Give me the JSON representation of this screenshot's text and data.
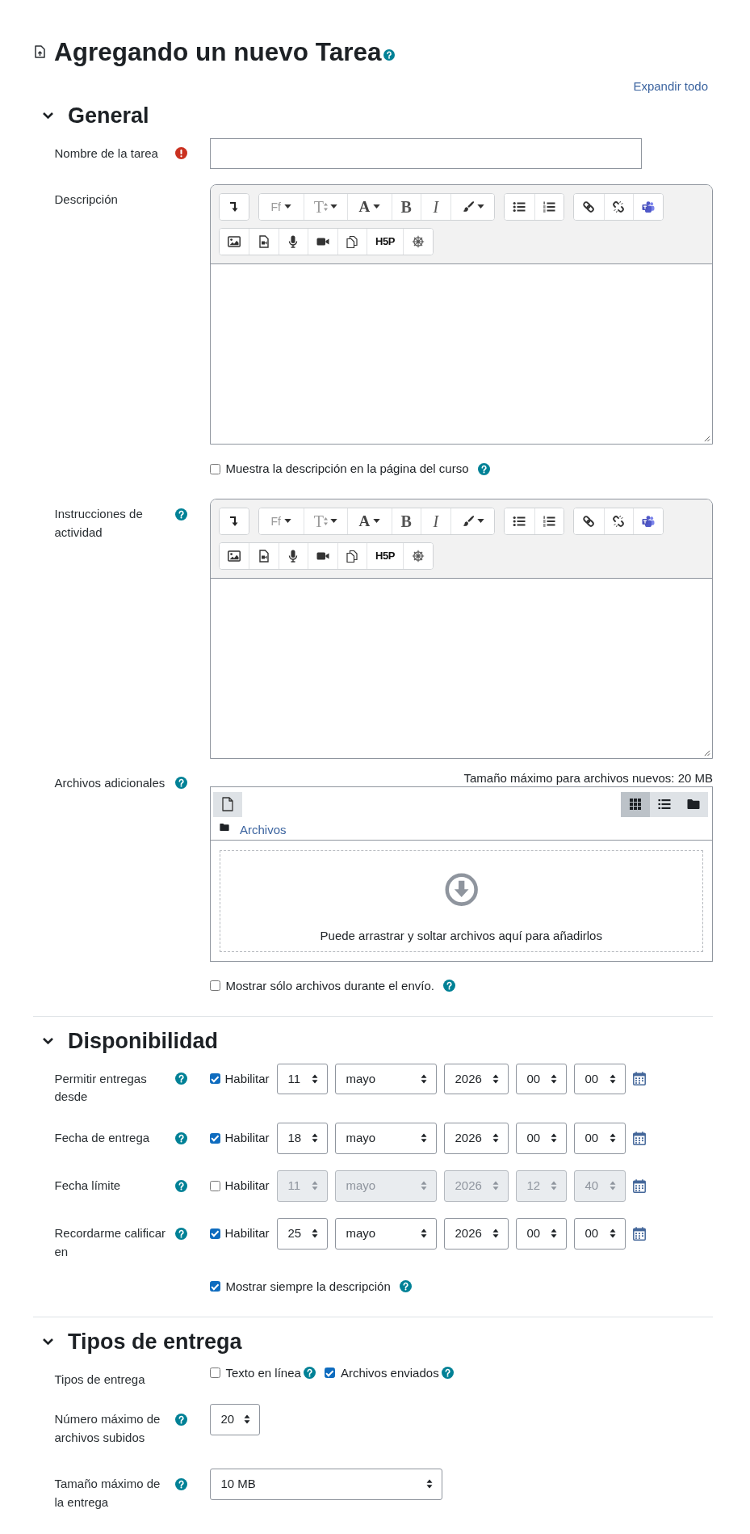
{
  "header": {
    "title": "Agregando un nuevo Tarea",
    "help": true,
    "expand_all": "Expandir todo"
  },
  "sections": [
    {
      "title": "General",
      "expanded": true,
      "fields": [
        {
          "kind": "text",
          "label": "Nombre de la tarea",
          "required": true,
          "help": false
        },
        {
          "kind": "editor",
          "label": "Descripción",
          "required": false,
          "help": false,
          "toolbar": [
            [
              [
                {
                  "kind": "expand"
                }
              ],
              [
                {
                  "kind": "font-family",
                  "glyph": "Ff"
                },
                {
                  "kind": "font-size",
                  "glyph": "T"
                },
                {
                  "kind": "font-color",
                  "glyph": "A"
                },
                {
                  "kind": "bold",
                  "glyph": "B"
                },
                {
                  "kind": "italic",
                  "glyph": "I"
                },
                {
                  "kind": "highlight"
                }
              ],
              [
                {
                  "kind": "bullets"
                },
                {
                  "kind": "numbers"
                }
              ],
              [
                {
                  "kind": "link"
                },
                {
                  "kind": "unlink"
                },
                {
                  "kind": "meeting"
                }
              ]
            ],
            [
              [
                {
                  "kind": "image"
                },
                {
                  "kind": "media"
                },
                {
                  "kind": "record-audio"
                },
                {
                  "kind": "record-video"
                },
                {
                  "kind": "manage-files"
                },
                {
                  "kind": "h5p",
                  "glyph": "H5P"
                },
                {
                  "kind": "wheel"
                }
              ]
            ]
          ]
        },
        {
          "kind": "checkbox",
          "label": "Muestra la descripción en la página del curso",
          "checked": false,
          "help": true
        },
        {
          "kind": "editor",
          "label": "Instrucciones de actividad",
          "required": false,
          "help": true,
          "toolbar": [
            [
              [
                {
                  "kind": "expand"
                }
              ],
              [
                {
                  "kind": "font-family",
                  "glyph": "Ff"
                },
                {
                  "kind": "font-size",
                  "glyph": "T"
                },
                {
                  "kind": "font-color",
                  "glyph": "A"
                },
                {
                  "kind": "bold",
                  "glyph": "B"
                },
                {
                  "kind": "italic",
                  "glyph": "I"
                },
                {
                  "kind": "highlight"
                }
              ],
              [
                {
                  "kind": "bullets"
                },
                {
                  "kind": "numbers"
                }
              ],
              [
                {
                  "kind": "link"
                },
                {
                  "kind": "unlink"
                },
                {
                  "kind": "meeting"
                }
              ]
            ],
            [
              [
                {
                  "kind": "image"
                },
                {
                  "kind": "media"
                },
                {
                  "kind": "record-audio"
                },
                {
                  "kind": "record-video"
                },
                {
                  "kind": "manage-files"
                },
                {
                  "kind": "h5p",
                  "glyph": "H5P"
                },
                {
                  "kind": "wheel"
                }
              ]
            ]
          ]
        },
        {
          "kind": "filemanager",
          "label": "Archivos adicionales",
          "required": false,
          "help": true,
          "max_size": "Tamaño máximo para archivos nuevos: 20 MB",
          "views": [
            {
              "kind": "icons",
              "selected": true
            },
            {
              "kind": "list",
              "selected": false
            },
            {
              "kind": "tree",
              "selected": false
            }
          ],
          "path": "Archivos",
          "dropzone": "Puede arrastrar y soltar archivos aquí para añadirlos"
        },
        {
          "kind": "checkbox",
          "label": "Mostrar sólo archivos durante el envío.",
          "checked": false,
          "help": true
        }
      ]
    },
    {
      "title": "Disponibilidad",
      "expanded": true,
      "fields": [
        {
          "kind": "datetime",
          "label": "Permitir entregas desde",
          "required": false,
          "help": true,
          "enable": {
            "label": "Habilitar",
            "checked": true
          },
          "disabled": false,
          "parts": [
            {
              "kind": "day",
              "value": "11"
            },
            {
              "kind": "month",
              "value": "mayo"
            },
            {
              "kind": "year",
              "value": "2026"
            },
            {
              "kind": "hour",
              "value": "00"
            },
            {
              "kind": "minute",
              "value": "00"
            }
          ]
        },
        {
          "kind": "datetime",
          "label": "Fecha de entrega",
          "required": false,
          "help": true,
          "enable": {
            "label": "Habilitar",
            "checked": true
          },
          "disabled": false,
          "parts": [
            {
              "kind": "day",
              "value": "18"
            },
            {
              "kind": "month",
              "value": "mayo"
            },
            {
              "kind": "year",
              "value": "2026"
            },
            {
              "kind": "hour",
              "value": "00"
            },
            {
              "kind": "minute",
              "value": "00"
            }
          ]
        },
        {
          "kind": "datetime",
          "label": "Fecha límite",
          "required": false,
          "help": true,
          "enable": {
            "label": "Habilitar",
            "checked": false
          },
          "disabled": true,
          "parts": [
            {
              "kind": "day",
              "value": "11"
            },
            {
              "kind": "month",
              "value": "mayo"
            },
            {
              "kind": "year",
              "value": "2026"
            },
            {
              "kind": "hour",
              "value": "12"
            },
            {
              "kind": "minute",
              "value": "40"
            }
          ]
        },
        {
          "kind": "datetime",
          "label": "Recordarme calificar en",
          "required": false,
          "help": true,
          "enable": {
            "label": "Habilitar",
            "checked": true
          },
          "disabled": false,
          "parts": [
            {
              "kind": "day",
              "value": "25"
            },
            {
              "kind": "month",
              "value": "mayo"
            },
            {
              "kind": "year",
              "value": "2026"
            },
            {
              "kind": "hour",
              "value": "00"
            },
            {
              "kind": "minute",
              "value": "00"
            }
          ]
        },
        {
          "kind": "checkbox",
          "label": "Mostrar siempre la descripción",
          "checked": true,
          "help": true
        }
      ]
    },
    {
      "title": "Tipos de entrega",
      "expanded": true,
      "fields": [
        {
          "kind": "checkgroup",
          "label": "Tipos de entrega",
          "required": false,
          "help": false,
          "options": [
            {
              "label": "Texto en línea",
              "checked": false,
              "help": true
            },
            {
              "label": "Archivos enviados",
              "checked": true,
              "help": true
            }
          ]
        },
        {
          "kind": "count",
          "label": "Número máximo de archivos subidos",
          "required": false,
          "help": true,
          "value": "20"
        },
        {
          "kind": "select",
          "label": "Tamaño máximo de la entrega",
          "required": false,
          "help": true,
          "value": "10 MB"
        }
      ]
    }
  ]
}
